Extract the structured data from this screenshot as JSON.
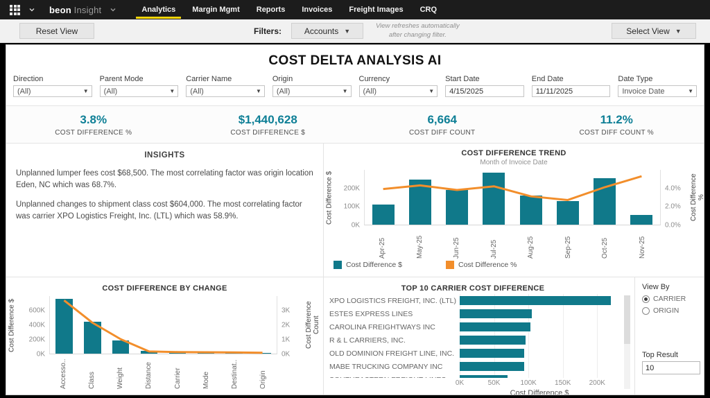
{
  "colors": {
    "teal": "#10798a",
    "orange": "#f28e2b",
    "kpi_teal": "#0e7f96",
    "yellow": "#f6d60a",
    "nav_bg": "#1c1c1c"
  },
  "nav": {
    "brand": {
      "name": "beon",
      "suffix": "Insight"
    },
    "tabs": [
      {
        "label": "Analytics",
        "active": true
      },
      {
        "label": "Margin Mgmt",
        "active": false
      },
      {
        "label": "Reports",
        "active": false
      },
      {
        "label": "Invoices",
        "active": false
      },
      {
        "label": "Freight Images",
        "active": false
      },
      {
        "label": "CRQ",
        "active": false
      }
    ]
  },
  "toolbar": {
    "reset_label": "Reset View",
    "filters_label": "Filters:",
    "accounts_label": "Accounts",
    "note_line1": "View refreshes automatically",
    "note_line2": "after changing filter.",
    "select_view_label": "Select View"
  },
  "title": "COST DELTA ANALYSIS AI",
  "filters": [
    {
      "label": "Direction",
      "value": "(All)",
      "type": "select"
    },
    {
      "label": "Parent Mode",
      "value": "(All)",
      "type": "select"
    },
    {
      "label": "Carrier Name",
      "value": "(All)",
      "type": "select"
    },
    {
      "label": "Origin",
      "value": "(All)",
      "type": "select"
    },
    {
      "label": "Currency",
      "value": "(All)",
      "type": "select"
    },
    {
      "label": "Start Date",
      "value": "4/15/2025",
      "type": "input"
    },
    {
      "label": "End Date",
      "value": "11/11/2025",
      "type": "input"
    },
    {
      "label": "Date Type",
      "value": "Invoice Date",
      "type": "select"
    }
  ],
  "kpis": [
    {
      "value": "3.8%",
      "label": "COST DIFFERENCE %"
    },
    {
      "value": "$1,440,628",
      "label": "COST DIFFERENCE $"
    },
    {
      "value": "6,664",
      "label": "COST DIFF COUNT"
    },
    {
      "value": "11.2%",
      "label": "COST DIFF COUNT %"
    }
  ],
  "insights": {
    "title": "INSIGHTS",
    "paragraphs": [
      "Unplanned lumper fees cost $68,500. The most correlating factor was origin location Eden, NC which was 68.7%.",
      "Unplanned changes to shipment class cost $604,000. The most correlating factor was carrier XPO Logistics Freight, Inc. (LTL) which was 58.9%."
    ]
  },
  "chart_data": [
    {
      "id": "trend",
      "type": "bar",
      "title": "COST DIFFERENCE TREND",
      "subtitle": "Month of Invoice Date",
      "categories": [
        "Apr-25",
        "May-25",
        "Jun-25",
        "Jul-25",
        "Aug-25",
        "Sep-25",
        "Oct-25",
        "Nov-25"
      ],
      "series": [
        {
          "name": "Cost Difference $",
          "kind": "bar",
          "color": "teal",
          "axis": "left",
          "values": [
            110000,
            245000,
            190000,
            285000,
            160000,
            130000,
            255000,
            55000
          ]
        },
        {
          "name": "Cost Difference %",
          "kind": "line",
          "color": "orange",
          "axis": "right",
          "values": [
            3.9,
            4.3,
            3.8,
            4.2,
            3.1,
            2.7,
            4.1,
            5.3
          ]
        }
      ],
      "left_axis": {
        "label": "Cost Difference $",
        "max": 300000,
        "ticks": [
          {
            "v": 200000,
            "t": "200K"
          },
          {
            "v": 100000,
            "t": "100K"
          },
          {
            "v": 0,
            "t": "0K"
          }
        ]
      },
      "right_axis": {
        "label": "Cost Difference %",
        "max": 6,
        "ticks": [
          {
            "v": 4,
            "t": "4.0%"
          },
          {
            "v": 2,
            "t": "2.0%"
          },
          {
            "v": 0,
            "t": "0.0%"
          }
        ]
      },
      "legend": [
        {
          "label": "Cost Difference $",
          "color": "teal"
        },
        {
          "label": "Cost Difference %",
          "color": "orange"
        }
      ],
      "grid": false,
      "legend_position": "bottom"
    },
    {
      "id": "by_change",
      "type": "bar",
      "title": "COST DIFFERENCE BY CHANGE",
      "categories": [
        "Accesso..",
        "Class",
        "Weight",
        "Distance",
        "Carrier",
        "Mode",
        "Destinat..",
        "Origin"
      ],
      "series": [
        {
          "name": "Cost Difference $",
          "kind": "bar",
          "color": "teal",
          "axis": "left",
          "values": [
            760000,
            440000,
            185000,
            35000,
            18000,
            12000,
            10000,
            6000
          ]
        },
        {
          "name": "Cost Difference Count",
          "kind": "line",
          "color": "orange",
          "axis": "right",
          "values": [
            3700,
            2150,
            1000,
            150,
            110,
            95,
            85,
            60
          ]
        }
      ],
      "left_axis": {
        "label": "Cost Difference $",
        "max": 800000,
        "ticks": [
          {
            "v": 600000,
            "t": "600K"
          },
          {
            "v": 400000,
            "t": "400K"
          },
          {
            "v": 200000,
            "t": "200K"
          },
          {
            "v": 0,
            "t": "0K"
          }
        ]
      },
      "right_axis": {
        "label": "Cost Difference Count",
        "max": 4000,
        "ticks": [
          {
            "v": 3000,
            "t": "3K"
          },
          {
            "v": 2000,
            "t": "2K"
          },
          {
            "v": 1000,
            "t": "1K"
          },
          {
            "v": 0,
            "t": "0K"
          }
        ]
      },
      "legend": [
        {
          "label": "Cost Difference $",
          "color": "teal"
        },
        {
          "label": "Cost Difference Count",
          "color": "orange"
        }
      ],
      "grid": false,
      "legend_position": "bottom"
    },
    {
      "id": "top_carrier",
      "type": "bar",
      "orientation": "horizontal",
      "title": "TOP 10 CARRIER COST DIFFERENCE",
      "categories": [
        "XPO LOGISTICS FREIGHT, INC. (LTL)",
        "ESTES EXPRESS LINES",
        "CAROLINA FREIGHTWAYS INC",
        "R & L CARRIERS, INC.",
        "OLD DOMINION FREIGHT LINE, INC.",
        "MABE TRUCKING COMPANY INC",
        "SOUTHEASTERN FREIGHT LINES"
      ],
      "values": [
        220000,
        105000,
        103000,
        96000,
        94000,
        94000,
        70000
      ],
      "xlabel": "Cost Difference $",
      "xmax": 232000,
      "x_ticks": [
        {
          "v": 0,
          "t": "0K"
        },
        {
          "v": 50000,
          "t": "50K"
        },
        {
          "v": 100000,
          "t": "100K"
        },
        {
          "v": 150000,
          "t": "150K"
        },
        {
          "v": 200000,
          "t": "200K"
        }
      ],
      "grid": true,
      "bar_color": "teal"
    }
  ],
  "view_by": {
    "label": "View By",
    "options": [
      {
        "label": "CARRIER",
        "selected": true
      },
      {
        "label": "ORIGIN",
        "selected": false
      }
    ],
    "top_result_label": "Top Result",
    "top_result_value": "10"
  }
}
